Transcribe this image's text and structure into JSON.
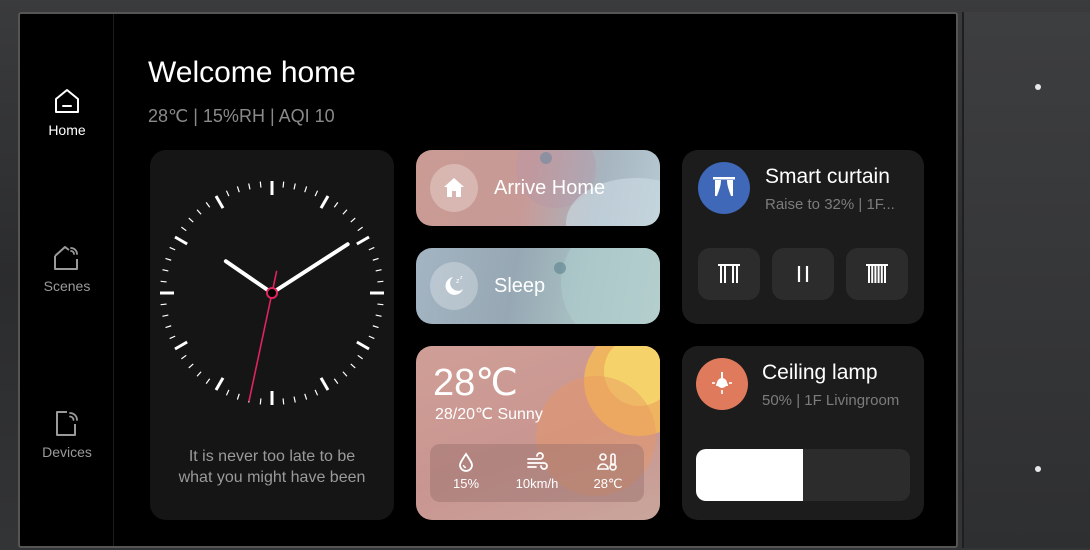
{
  "nav": {
    "items": [
      {
        "label": "Home",
        "icon": "home-icon",
        "active": true
      },
      {
        "label": "Scenes",
        "icon": "scenes-icon",
        "active": false
      },
      {
        "label": "Devices",
        "icon": "devices-icon",
        "active": false
      }
    ]
  },
  "header": {
    "title": "Welcome home",
    "subtitle": "28℃  |  15%RH  |  AQI 10"
  },
  "clock": {
    "hours": 10,
    "minutes": 9,
    "seconds": 32,
    "quote_line1": "It is never too late to be",
    "quote_line2": "what you might have been",
    "second_hand_color": "#e0245e"
  },
  "scenes": {
    "arrive_home": {
      "label": "Arrive Home",
      "icon": "house-icon"
    },
    "sleep": {
      "label": "Sleep",
      "icon": "moon-icon"
    }
  },
  "weather": {
    "temp": "28℃",
    "range": "28/20℃  Sunny",
    "humidity": "15%",
    "wind": "10km/h",
    "feels": "28℃"
  },
  "curtain": {
    "name": "Smart curtain",
    "status": "Raise to 32% | 1F...",
    "icon_color": "#3f68b8",
    "buttons": [
      "open-curtain-icon",
      "pause-icon",
      "close-curtain-icon"
    ]
  },
  "lamp": {
    "name": "Ceiling lamp",
    "status": "50% | 1F Livingroom",
    "icon_color": "#e07a5c",
    "brightness": 0.5
  }
}
